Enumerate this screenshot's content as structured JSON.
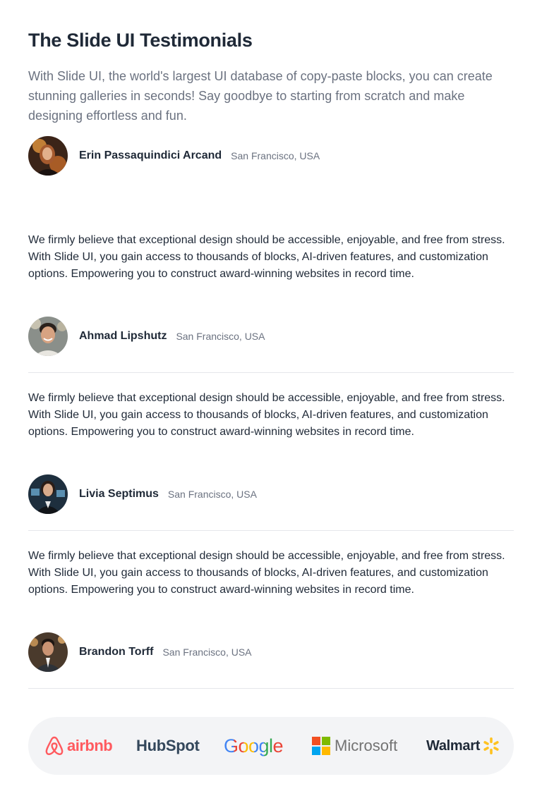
{
  "header": {
    "title": "The Slide UI Testimonials",
    "intro": "With Slide UI, the world's largest UI database of copy-paste blocks, you can create stunning galleries in seconds! Say goodbye to starting from scratch and make designing effortless and fun."
  },
  "featured": {
    "name": "Erin Passaquindici Arcand",
    "location": "San Francisco, USA"
  },
  "testimonials": [
    {
      "quote": "We firmly believe that exceptional design should be accessible, enjoyable, and free from stress. With Slide UI, you gain access to thousands of blocks, AI-driven features, and customization options. Empowering you to construct award-winning websites in record time.",
      "name": "Ahmad Lipshutz",
      "location": "San Francisco, USA"
    },
    {
      "quote": "We firmly believe that exceptional design should be accessible, enjoyable, and free from stress. With Slide UI, you gain access to thousands of blocks, AI-driven features, and customization options. Empowering you to construct award-winning websites in record time.",
      "name": "Livia Septimus",
      "location": "San Francisco, USA"
    },
    {
      "quote": "We firmly believe that exceptional design should be accessible, enjoyable, and free from stress. With Slide UI, you gain access to thousands of blocks, AI-driven features, and customization options. Empowering you to construct award-winning websites in record time.",
      "name": "Brandon Torff",
      "location": "San Francisco, USA"
    }
  ],
  "logos": {
    "airbnb": "airbnb",
    "hubspot": "HubSpot",
    "google": "Google",
    "microsoft": "Microsoft",
    "walmart": "Walmart"
  },
  "colors": {
    "airbnb": "#ff5a5f",
    "hubspot_text": "#33475b",
    "hubspot_accent": "#ff7a59",
    "microsoft_red": "#f25022",
    "microsoft_green": "#7fba00",
    "microsoft_blue": "#00a4ef",
    "microsoft_yellow": "#ffb900",
    "walmart_spark": "#ffc220"
  }
}
